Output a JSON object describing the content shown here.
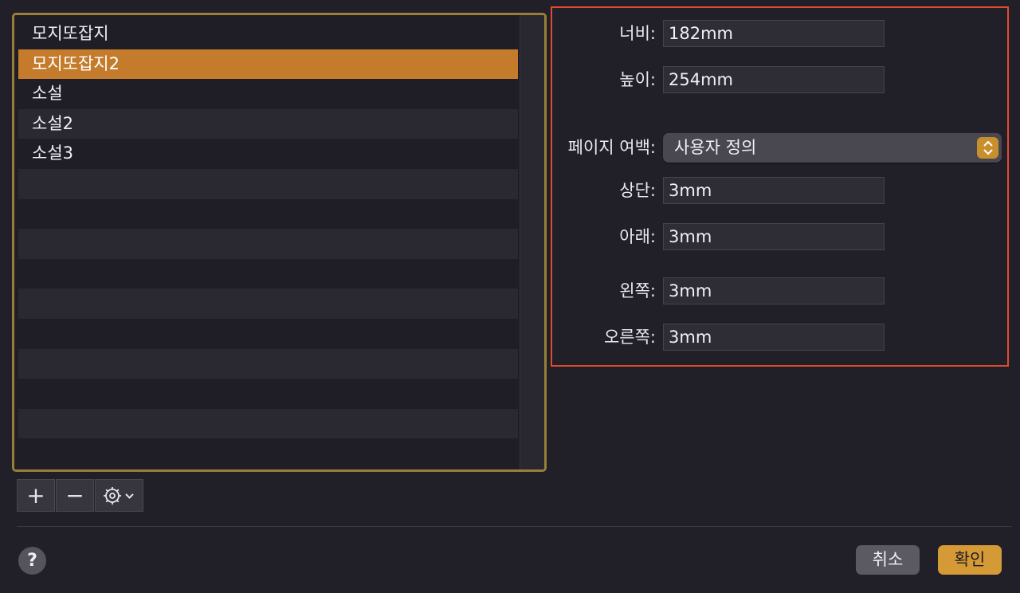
{
  "list": {
    "items": [
      {
        "label": "모지또잡지",
        "selected": false
      },
      {
        "label": "모지또잡지2",
        "selected": true
      },
      {
        "label": "소설",
        "selected": false
      },
      {
        "label": "소설2",
        "selected": false
      },
      {
        "label": "소설3",
        "selected": false
      }
    ]
  },
  "toolbar": {
    "add_label": "+",
    "remove_label": "−"
  },
  "size": {
    "width_label": "너비:",
    "width_value": "182mm",
    "height_label": "높이:",
    "height_value": "254mm"
  },
  "margins": {
    "label": "페이지 여백:",
    "preset": "사용자 정의",
    "top_label": "상단:",
    "top_value": "3mm",
    "bottom_label": "아래:",
    "bottom_value": "3mm",
    "left_label": "왼쪽:",
    "left_value": "3mm",
    "right_label": "오른쪽:",
    "right_value": "3mm"
  },
  "footer": {
    "help_label": "?",
    "cancel_label": "취소",
    "ok_label": "확인"
  },
  "colors": {
    "accent": "#c47c2c",
    "frame": "#978036",
    "highlight": "#e24a30",
    "ok_button": "#d59a35"
  },
  "icons": {
    "add": "plus-icon",
    "remove": "minus-icon",
    "gear": "gear-icon",
    "popup": "up-down-chevron-icon",
    "help": "question-icon"
  }
}
